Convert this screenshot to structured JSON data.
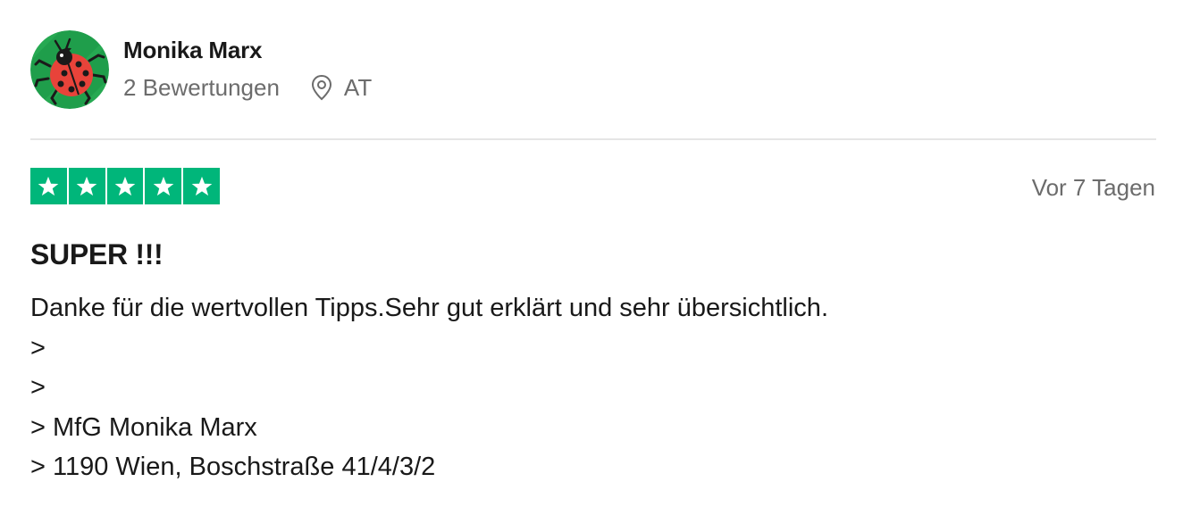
{
  "consumer": {
    "name": "Monika Marx",
    "review_count": "2 Bewertungen",
    "location": "AT",
    "avatar_icon": "ladybug-avatar-icon",
    "location_icon": "location-pin-icon"
  },
  "review": {
    "rating": 5,
    "rating_max": 5,
    "star_color": "#00b67a",
    "date": "Vor 7 Tagen",
    "title": "SUPER !!!",
    "body_lines": [
      "Danke für die wertvollen Tipps.Sehr gut erklärt und sehr übersichtlich.",
      ">",
      ">",
      "> MfG Monika Marx",
      "> 1190 Wien, Boschstraße 41/4/3/2"
    ]
  }
}
